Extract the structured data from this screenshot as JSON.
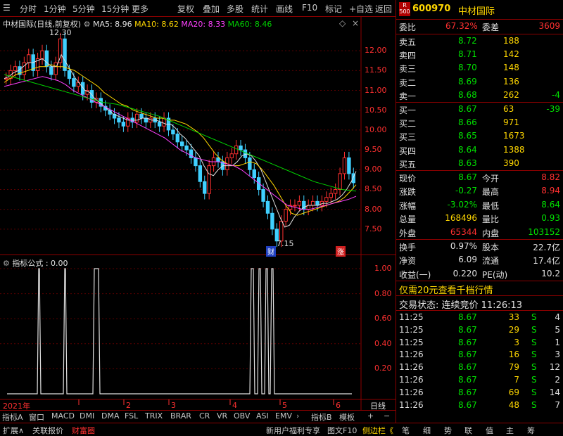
{
  "toolbar": {
    "left_items": [
      "分时",
      "1分钟",
      "5分钟",
      "15分钟",
      "更多"
    ],
    "right_items": [
      "复权",
      "叠加",
      "多股",
      "统计",
      "画线",
      "F10",
      "标记",
      "+自选",
      "返回"
    ]
  },
  "chart_header": {
    "stock_title": "中材国际(日线,前复权)",
    "ma5": "MA5: 8.96",
    "ma10": "MA10: 8.62",
    "ma20": "MA20: 8.33",
    "ma60": "MA60: 8.46",
    "high_label": "12.30",
    "low_label": "7.15",
    "marker_cai": "财",
    "marker_zhang": "涨"
  },
  "price_axis": [
    "12.00",
    "11.50",
    "11.00",
    "10.50",
    "10.00",
    "9.50",
    "9.00",
    "8.50",
    "8.00",
    "7.50"
  ],
  "indicator": {
    "title": "指标公式 : 0.00",
    "axis": [
      "1.00",
      "0.80",
      "0.60",
      "0.40",
      "0.20"
    ]
  },
  "time_axis": {
    "year": "2021年",
    "months": [
      "2",
      "3",
      "4",
      "5",
      "6"
    ],
    "period": "日线"
  },
  "bottom_tabs": [
    "指标A",
    "窗口",
    "MACD",
    "DMI",
    "DMA",
    "FSL",
    "TRIX",
    "BRAR",
    "CR",
    "VR",
    "OBV",
    "ASI",
    "EMV",
    "指标B",
    "模板"
  ],
  "footer": {
    "left": [
      "扩展∧",
      "关联报价",
      "财富圈"
    ],
    "right": [
      "新用户福利专享",
      "图文F10",
      "侧边栏《"
    ],
    "side_tabs": [
      "笔",
      "细",
      "势",
      "联",
      "值",
      "主",
      "筹"
    ]
  },
  "quote": {
    "code": "600970",
    "name": "中材国际",
    "badge_r": "R",
    "badge_500": "500",
    "weibi_label": "委比",
    "weibi_value": "67.32%",
    "weicha_label": "委差",
    "weicha_value": "3609",
    "sell": [
      {
        "label": "卖五",
        "price": "8.72",
        "vol": "188",
        "chg": ""
      },
      {
        "label": "卖四",
        "price": "8.71",
        "vol": "142",
        "chg": ""
      },
      {
        "label": "卖三",
        "price": "8.70",
        "vol": "148",
        "chg": ""
      },
      {
        "label": "卖二",
        "price": "8.69",
        "vol": "136",
        "chg": ""
      },
      {
        "label": "卖一",
        "price": "8.68",
        "vol": "262",
        "chg": "-4"
      }
    ],
    "buy": [
      {
        "label": "买一",
        "price": "8.67",
        "vol": "63",
        "chg": "-39"
      },
      {
        "label": "买二",
        "price": "8.66",
        "vol": "971",
        "chg": ""
      },
      {
        "label": "买三",
        "price": "8.65",
        "vol": "1673",
        "chg": ""
      },
      {
        "label": "买四",
        "price": "8.64",
        "vol": "1388",
        "chg": ""
      },
      {
        "label": "买五",
        "price": "8.63",
        "vol": "390",
        "chg": ""
      }
    ],
    "stats": [
      {
        "l1": "现价",
        "v1": "8.67",
        "l2": "今开",
        "v2": "8.82"
      },
      {
        "l1": "涨跌",
        "v1": "-0.27",
        "l2": "最高",
        "v2": "8.94"
      },
      {
        "l1": "涨幅",
        "v1": "-3.02%",
        "l2": "最低",
        "v2": "8.64"
      },
      {
        "l1": "总量",
        "v1": "168496",
        "l2": "量比",
        "v2": "0.93"
      },
      {
        "l1": "外盘",
        "v1": "65344",
        "l2": "内盘",
        "v2": "103152"
      }
    ],
    "fin": [
      {
        "l1": "换手",
        "v1": "0.97%",
        "l2": "股本",
        "v2": "22.7亿"
      },
      {
        "l1": "净资",
        "v1": "6.09",
        "l2": "流通",
        "v2": "17.4亿"
      },
      {
        "l1": "收益(一)",
        "v1": "0.220",
        "l2": "PE(动)",
        "v2": "10.2"
      }
    ],
    "promo": "仅需20元查看千档行情",
    "status": "交易状态: 连续竞价 11:26:13",
    "ticks": [
      {
        "time": "11:25",
        "price": "8.67",
        "vol": "33",
        "dir": "S",
        "n": "4"
      },
      {
        "time": "11:25",
        "price": "8.67",
        "vol": "29",
        "dir": "S",
        "n": "5"
      },
      {
        "time": "11:25",
        "price": "8.67",
        "vol": "3",
        "dir": "S",
        "n": "1"
      },
      {
        "time": "11:26",
        "price": "8.67",
        "vol": "16",
        "dir": "S",
        "n": "3"
      },
      {
        "time": "11:26",
        "price": "8.67",
        "vol": "79",
        "dir": "S",
        "n": "12"
      },
      {
        "time": "11:26",
        "price": "8.67",
        "vol": "7",
        "dir": "S",
        "n": "2"
      },
      {
        "time": "11:26",
        "price": "8.67",
        "vol": "69",
        "dir": "S",
        "n": "14"
      },
      {
        "time": "11:26",
        "price": "8.67",
        "vol": "48",
        "dir": "S",
        "n": "7"
      }
    ]
  },
  "chart_data": {
    "type": "line",
    "candles_close": [
      11.3,
      11.5,
      11.6,
      11.4,
      11.7,
      11.9,
      11.5,
      11.8,
      12.0,
      11.6,
      11.4,
      11.7,
      12.3,
      11.5,
      11.3,
      11.1,
      11.2,
      10.9,
      11.0,
      10.7,
      10.8,
      10.6,
      10.5,
      10.4,
      10.3,
      10.2,
      10.1,
      10.3,
      10.2,
      10.4,
      10.3,
      10.2,
      10.3,
      10.2,
      10.1,
      10.3,
      10.0,
      9.9,
      9.7,
      9.6,
      9.5,
      9.3,
      9.1,
      8.7,
      8.4,
      9.1,
      9.3,
      9.2,
      9.0,
      9.3,
      9.4,
      9.6,
      9.5,
      9.3,
      9.0,
      8.8,
      8.5,
      8.2,
      7.9,
      7.5,
      7.2,
      7.7,
      8.0,
      8.1,
      8.1,
      8.2,
      8.0,
      8.1,
      8.2,
      8.1,
      8.2,
      8.3,
      8.4,
      8.5,
      8.9,
      9.3,
      8.9,
      8.67
    ],
    "ma5": [
      11.3,
      11.35,
      11.45,
      11.5,
      11.6,
      11.7,
      11.7,
      11.75,
      11.8,
      11.7,
      11.6,
      11.6,
      11.9,
      11.7,
      11.5,
      11.3,
      11.15,
      11.0,
      10.95,
      10.8,
      10.7,
      10.6,
      10.5,
      10.4,
      10.35,
      10.3,
      10.25,
      10.25,
      10.25,
      10.3,
      10.3,
      10.25,
      10.25,
      10.2,
      10.15,
      10.15,
      10.05,
      9.9,
      9.8,
      9.65,
      9.5,
      9.35,
      9.1,
      8.9,
      8.85,
      9.0,
      9.1,
      9.1,
      9.1,
      9.2,
      9.35,
      9.4,
      9.35,
      9.2,
      9.0,
      8.7,
      8.4,
      8.1,
      7.8,
      7.55,
      7.6,
      7.8,
      7.95,
      8.05,
      8.1,
      8.1,
      8.1,
      8.15,
      8.15,
      8.2,
      8.25,
      8.35,
      8.5,
      8.7,
      8.96
    ],
    "ma10": [
      11.2,
      11.3,
      11.4,
      11.45,
      11.5,
      11.55,
      11.6,
      11.6,
      11.65,
      11.6,
      11.6,
      11.55,
      11.5,
      11.4,
      11.3,
      11.2,
      11.1,
      10.95,
      10.85,
      10.75,
      10.65,
      10.6,
      10.5,
      10.45,
      10.4,
      10.35,
      10.3,
      10.3,
      10.25,
      10.25,
      10.2,
      10.15,
      10.05,
      9.95,
      9.8,
      9.6,
      9.4,
      9.25,
      9.15,
      9.1,
      9.1,
      9.15,
      9.2,
      9.15,
      9.0,
      8.8,
      8.6,
      8.35,
      8.1,
      7.9,
      7.85,
      7.9,
      7.95,
      8.0,
      8.05,
      8.1,
      8.15,
      8.2,
      8.3,
      8.45,
      8.62
    ],
    "ma20": [
      11.1,
      11.15,
      11.2,
      11.25,
      11.3,
      11.35,
      11.3,
      11.25,
      11.15,
      11.0,
      10.9,
      10.8,
      10.7,
      10.6,
      10.5,
      10.4,
      10.3,
      10.2,
      10.1,
      10.0,
      9.9,
      9.8,
      9.65,
      9.5,
      9.4,
      9.3,
      9.25,
      9.2,
      9.2,
      9.15,
      9.1,
      9.0,
      8.85,
      8.7,
      8.55,
      8.4,
      8.25,
      8.1,
      8.05,
      8.0,
      8.0,
      8.05,
      8.1,
      8.15,
      8.2,
      8.25,
      8.33
    ],
    "ma60": [
      11.4,
      11.3,
      11.2,
      11.1,
      11.0,
      10.9,
      10.8,
      10.7,
      10.65,
      10.55,
      10.45,
      10.35,
      10.2,
      10.05,
      9.9,
      9.75,
      9.6,
      9.45,
      9.3,
      9.15,
      9.0,
      8.85,
      8.7,
      8.6,
      8.5,
      8.46
    ],
    "ylim": [
      7.0,
      12.5
    ]
  }
}
